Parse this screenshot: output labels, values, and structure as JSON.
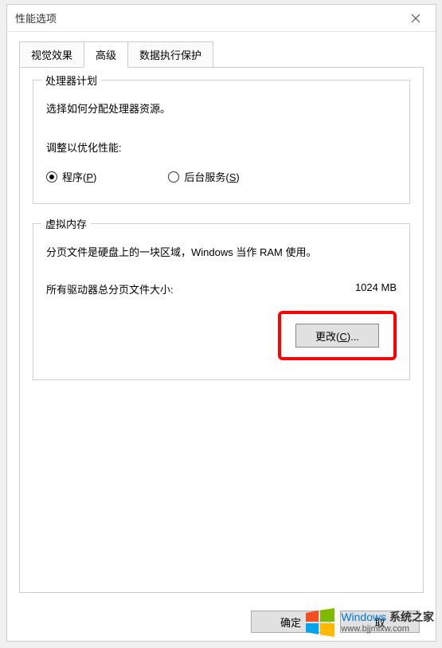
{
  "dialog": {
    "title": "性能选项"
  },
  "tabs": {
    "visual_effects": "视觉效果",
    "advanced": "高级",
    "dep": "数据执行保护"
  },
  "processor": {
    "legend": "处理器计划",
    "desc": "选择如何分配处理器资源。",
    "adjust_label": "调整以优化性能:",
    "programs_label": "程序(",
    "programs_key": "P",
    "programs_label_end": ")",
    "background_label": "后台服务(",
    "background_key": "S",
    "background_label_end": ")"
  },
  "virtual_memory": {
    "legend": "虚拟内存",
    "desc": "分页文件是硬盘上的一块区域，Windows 当作 RAM 使用。",
    "total_label": "所有驱动器总分页文件大小:",
    "total_value": "1024 MB",
    "change_label_pre": "更改(",
    "change_key": "C",
    "change_label_post": ")..."
  },
  "buttons": {
    "ok": "确定",
    "cancel": "取"
  },
  "watermark": {
    "brand_prefix": "Windows",
    "brand_suffix": "系统之家",
    "url": "www.bjjmlxw.com"
  }
}
